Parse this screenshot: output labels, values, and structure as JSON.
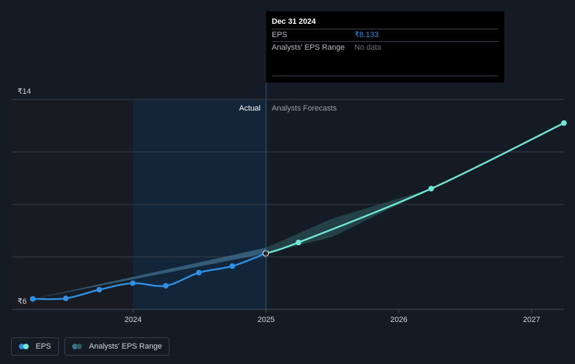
{
  "chart_data": {
    "type": "line",
    "y_tick_labels": [
      "₹14",
      "₹6"
    ],
    "x_tick_labels": [
      "2024",
      "2025",
      "2026",
      "2027"
    ],
    "divider_labels": {
      "actual": "Actual",
      "forecast": "Analysts Forecasts"
    },
    "ylim": [
      6,
      14
    ],
    "grid": true,
    "series": [
      {
        "name": "EPS",
        "color": "#2f8fe3",
        "points": [
          {
            "x": "2023-03-31",
            "y": 6.4
          },
          {
            "x": "2023-06-30",
            "y": 6.42
          },
          {
            "x": "2023-09-30",
            "y": 6.75
          },
          {
            "x": "2023-12-31",
            "y": 7.0
          },
          {
            "x": "2024-03-31",
            "y": 6.9
          },
          {
            "x": "2024-06-30",
            "y": 7.4
          },
          {
            "x": "2024-09-30",
            "y": 7.65
          },
          {
            "x": "2024-12-31",
            "y": 8.133
          }
        ]
      },
      {
        "name": "EPS Forecast",
        "color": "#71e7d6",
        "points": [
          {
            "x": "2024-12-31",
            "y": 8.133
          },
          {
            "x": "2025-03-31",
            "y": 8.55
          },
          {
            "x": "2026-03-31",
            "y": 10.6
          },
          {
            "x": "2027-03-31",
            "y": 13.1
          }
        ]
      }
    ],
    "analyst_range": [
      {
        "x": "2023-03-31",
        "low": 6.4,
        "high": 6.4
      },
      {
        "x": "2024-12-31",
        "low": 8.13,
        "high": 8.35
      },
      {
        "x": "2025-06-30",
        "low": 8.75,
        "high": 9.45
      },
      {
        "x": "2026-03-31",
        "low": 10.6,
        "high": 10.6
      }
    ]
  },
  "tooltip": {
    "date": "Dec 31 2024",
    "eps_label": "EPS",
    "eps_value": "₹8.133",
    "range_label": "Analysts' EPS Range",
    "range_value": "No data"
  },
  "legend": {
    "eps_label": "EPS",
    "range_label": "Analysts' EPS Range",
    "eps_colors": [
      "#2f8fe3",
      "#71e7d6"
    ],
    "range_colors": [
      "#3f6f8f",
      "#2d5b5f"
    ]
  }
}
